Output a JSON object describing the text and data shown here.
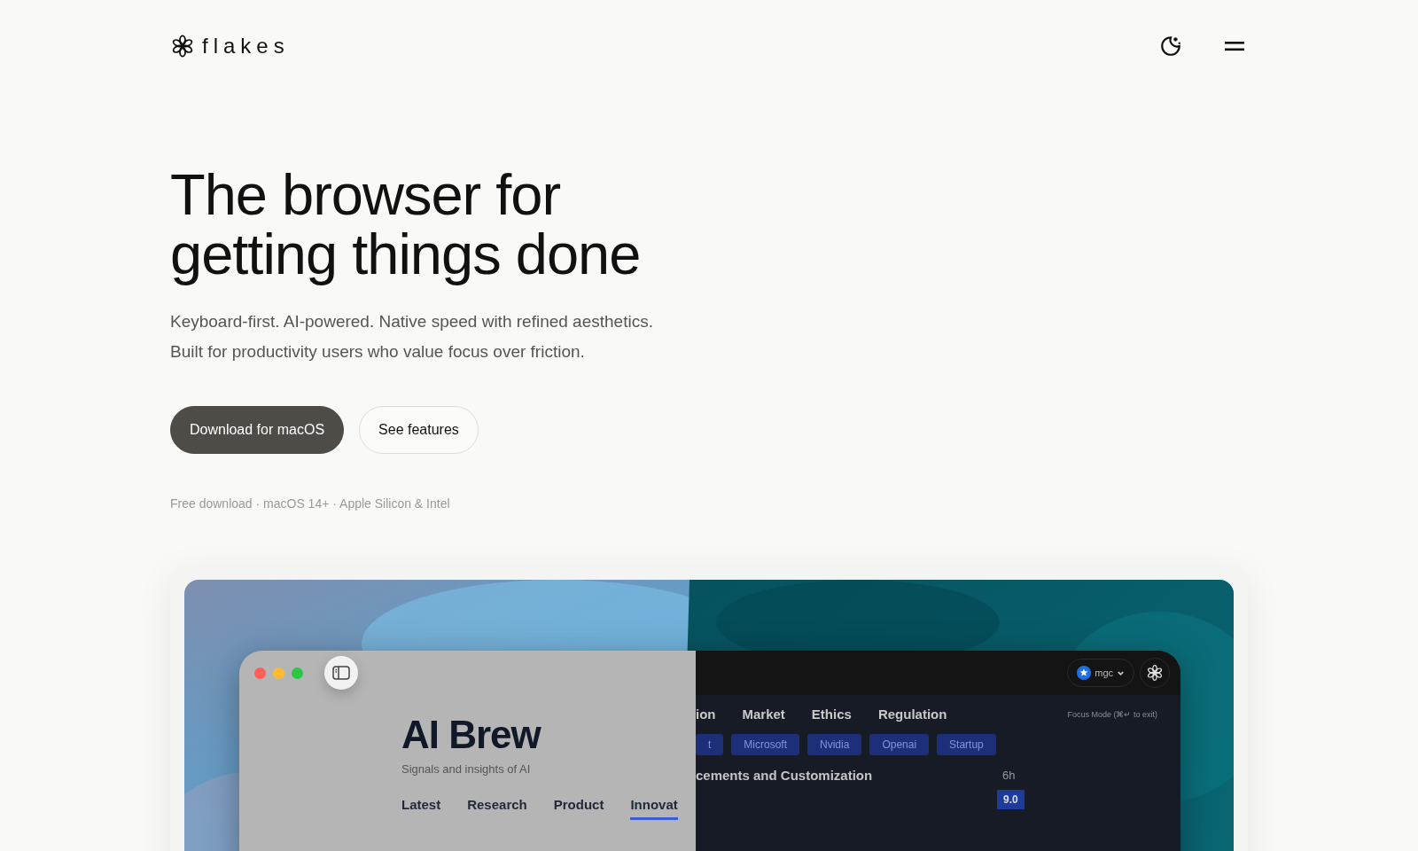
{
  "brand": {
    "name": "flakes"
  },
  "hero": {
    "title_lines": [
      "The browser for",
      "getting things done"
    ],
    "description": "Keyboard-first. AI-powered. Native speed with refined aesthetics. Built for productivity users who value focus over friction.",
    "buttons": [
      {
        "label": "Download for macOS",
        "kind": "primary"
      },
      {
        "label": "See features",
        "kind": "secondary"
      }
    ],
    "note": "Free download · macOS 14+ · Apple Silicon & Intel"
  },
  "preview": {
    "left": {
      "title": "AI Brew",
      "subtitle": "Signals and insights of AI",
      "tabs": [
        {
          "label": "Latest",
          "selected": false
        },
        {
          "label": "Research",
          "selected": false
        },
        {
          "label": "Product",
          "selected": false
        },
        {
          "label": "Innovat",
          "selected": true
        }
      ]
    },
    "right": {
      "account": "mgc",
      "tabs": [
        "ion",
        "Market",
        "Ethics",
        "Regulation"
      ],
      "focus_hint": "Focus Mode (⌘↵ to exit)",
      "tags": [
        "t",
        "Microsoft",
        "Nvidia",
        "Openai",
        "Startup"
      ],
      "story": {
        "title": "cements and Customization",
        "age": "6h",
        "score": "9.0"
      }
    }
  }
}
